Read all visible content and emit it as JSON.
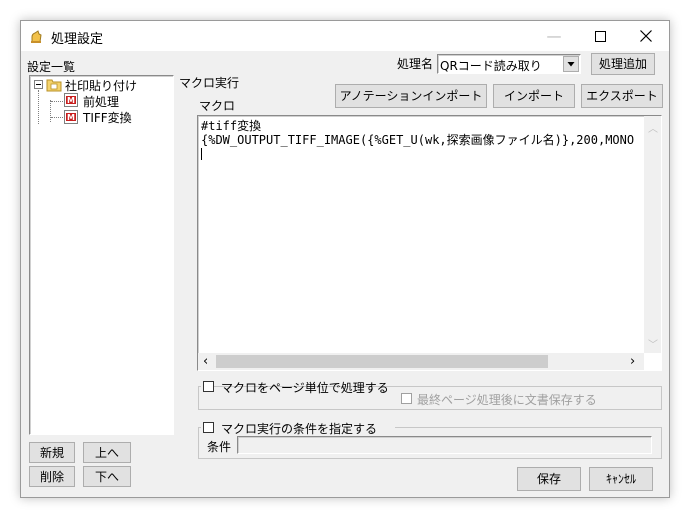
{
  "window": {
    "title": "処理設定"
  },
  "list_label": "設定一覧",
  "tree": {
    "root": "社印貼り付け",
    "children": [
      "前処理",
      "TIFF変換"
    ]
  },
  "process_name": {
    "label": "処理名",
    "selected": "QRコード読み取り"
  },
  "buttons": {
    "add_process": "処理追加",
    "annotation_import": "アノテーションインポート",
    "import": "インポート",
    "export": "エクスポート",
    "new": "新規",
    "up": "上へ",
    "delete": "削除",
    "down": "下へ",
    "save": "保存",
    "cancel": "ｷｬﾝｾﾙ"
  },
  "macro_exec_label": "マクロ実行",
  "macro_label": "マクロ",
  "macro_lines": [
    "#tiff変換",
    "{%DW_OUTPUT_TIFF_IMAGE({%GET_U(wk,探索画像ファイル名)},200,MONO"
  ],
  "page_unit": {
    "label": "マクロをページ単位で処理する",
    "sub_label": "最終ページ処理後に文書保存する"
  },
  "condition": {
    "label": "マクロ実行の条件を指定する",
    "field_label": "条件",
    "value": ""
  }
}
